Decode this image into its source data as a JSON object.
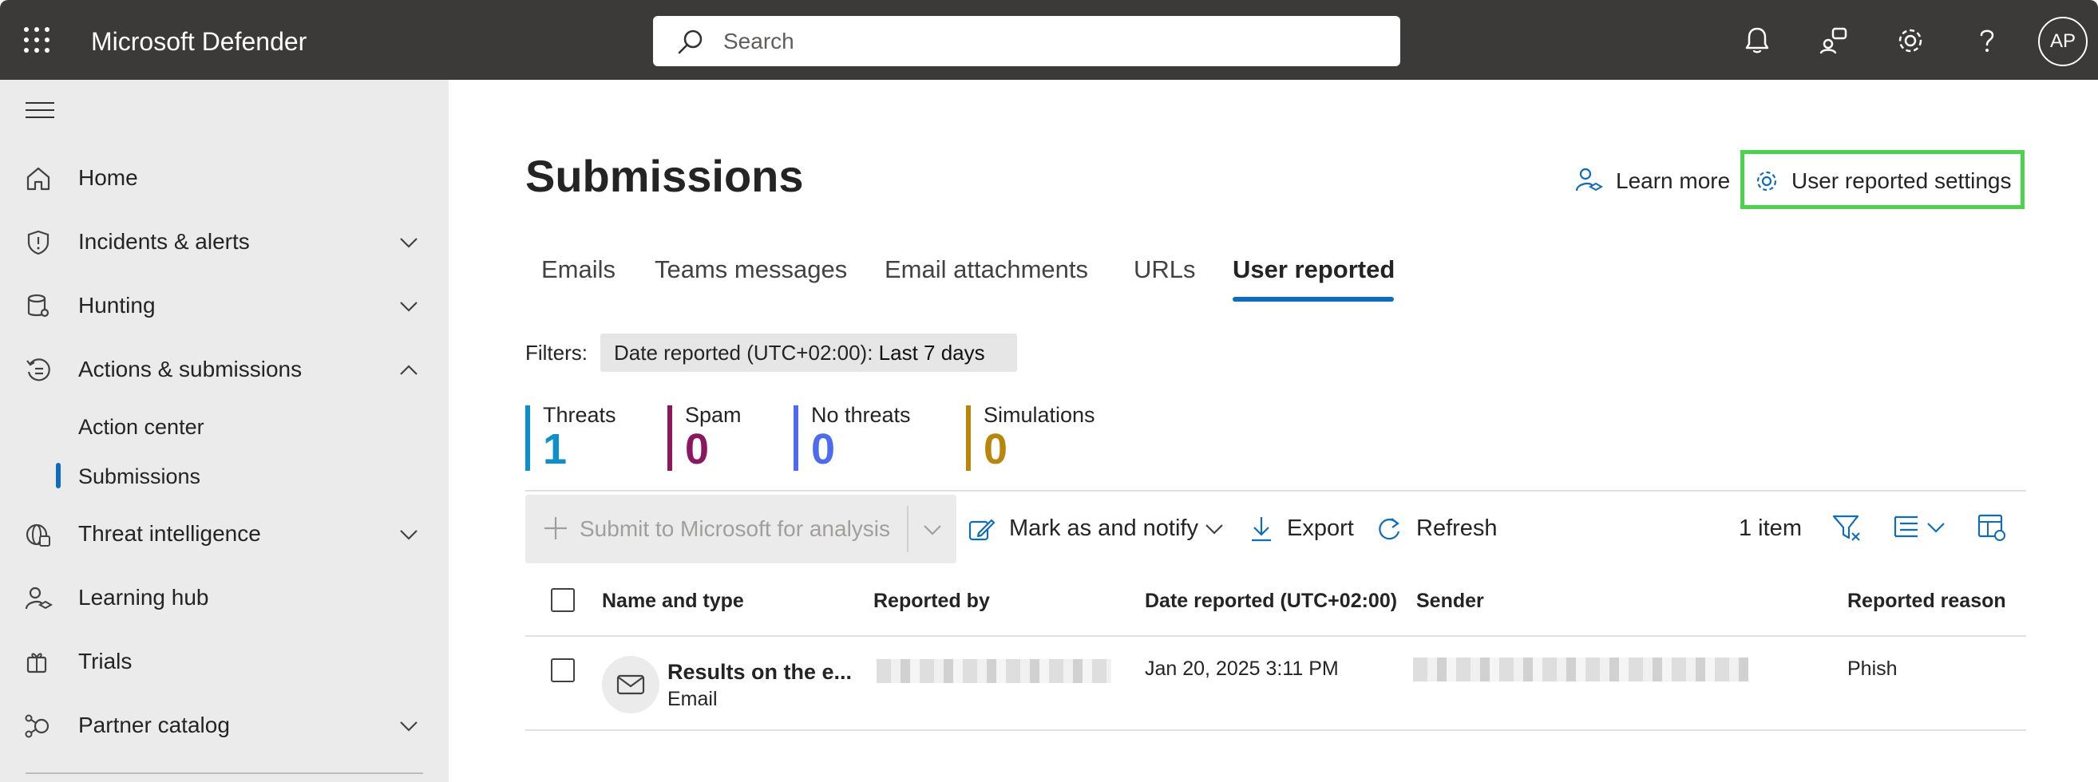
{
  "topbar": {
    "app_title": "Microsoft Defender",
    "search_placeholder": "Search",
    "avatar_initials": "AP",
    "icons": [
      "waffle-icon",
      "bell-icon",
      "community-icon",
      "gear-icon",
      "help-icon"
    ]
  },
  "sidebar": {
    "items": [
      {
        "label": "Home",
        "icon": "home-icon"
      },
      {
        "label": "Incidents & alerts",
        "icon": "shield-icon",
        "expandable": true
      },
      {
        "label": "Hunting",
        "icon": "database-icon",
        "expandable": true
      },
      {
        "label": "Actions & submissions",
        "icon": "history-icon",
        "expanded": true
      },
      {
        "label": "Threat intelligence",
        "icon": "globe-icon",
        "expandable": true
      },
      {
        "label": "Learning hub",
        "icon": "learning-icon"
      },
      {
        "label": "Trials",
        "icon": "trials-icon"
      },
      {
        "label": "Partner catalog",
        "icon": "partner-icon",
        "expandable": true
      }
    ],
    "sub_items": [
      "Action center",
      "Submissions"
    ],
    "selected_sub_item": "Submissions"
  },
  "page": {
    "title": "Submissions",
    "learn_more": "Learn more",
    "user_reported_settings": "User reported settings"
  },
  "tabs": [
    "Emails",
    "Teams messages",
    "Email attachments",
    "URLs",
    "User reported"
  ],
  "active_tab": "User reported",
  "filters": {
    "label": "Filters:",
    "chip_key": "Date reported (UTC+02:00):",
    "chip_value": "Last 7 days"
  },
  "stats": [
    {
      "label": "Threats",
      "value": "1",
      "color": "#0e8fc9"
    },
    {
      "label": "Spam",
      "value": "0",
      "color": "#8a1760"
    },
    {
      "label": "No threats",
      "value": "0",
      "color": "#4f6bed"
    },
    {
      "label": "Simulations",
      "value": "0",
      "color": "#b8860b"
    }
  ],
  "commands": {
    "submit": "Submit to Microsoft for analysis",
    "mark_notify": "Mark as and notify",
    "export": "Export",
    "refresh": "Refresh",
    "item_count": "1 item"
  },
  "table": {
    "columns": [
      "Name and type",
      "Reported by",
      "Date reported (UTC+02:00)",
      "Sender",
      "Reported reason"
    ],
    "rows": [
      {
        "name": "Results on the e...",
        "type": "Email",
        "date_reported": "Jan 20, 2025 3:11 PM",
        "reported_reason": "Phish"
      }
    ]
  }
}
